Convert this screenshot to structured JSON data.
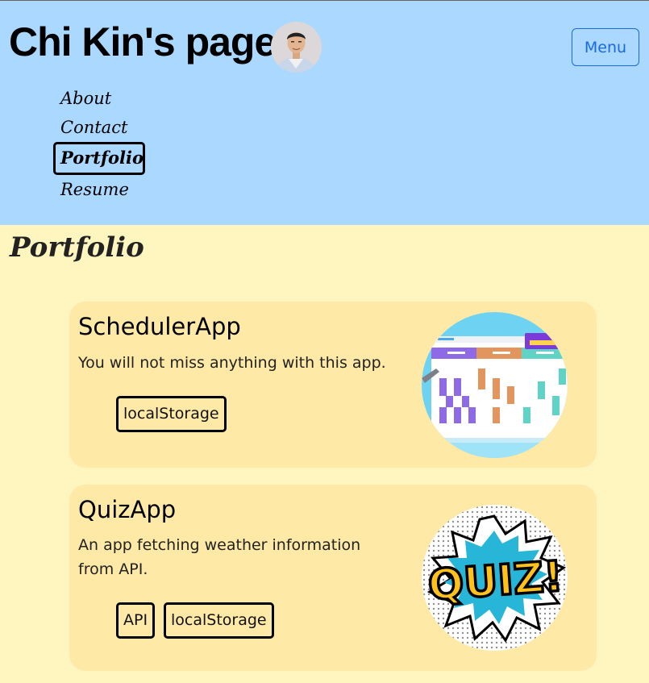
{
  "header": {
    "title": "Chi Kin's page",
    "menu_label": "Menu",
    "accent": "#1a6ae0",
    "background": "#aad8ff"
  },
  "nav": {
    "items": [
      {
        "label": "About"
      },
      {
        "label": "Contact"
      },
      {
        "label": "Portfolio",
        "active": true
      },
      {
        "label": "Resume"
      }
    ]
  },
  "portfolio": {
    "title": "Portfolio",
    "projects": [
      {
        "name": "SchedulerApp",
        "description": "You will not miss anything with this app.",
        "tags": [
          "localStorage"
        ],
        "image_icon": "scheduler-calendar-image"
      },
      {
        "name": "QuizApp",
        "description": "An app fetching weather information from API.",
        "tags": [
          "API",
          "localStorage"
        ],
        "image_icon": "quiz-comic-image",
        "image_text": "QUIZ!"
      }
    ]
  }
}
